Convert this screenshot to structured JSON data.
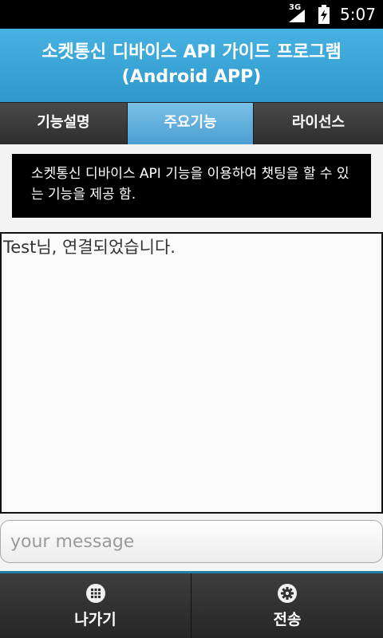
{
  "status_bar": {
    "network": "3G",
    "time": "5:07"
  },
  "header": {
    "title_line1": "소켓통신 디바이스 API 가이드 프로그램",
    "title_line2": "(Android APP)"
  },
  "tabs": [
    {
      "label": "기능설명",
      "active": false
    },
    {
      "label": "주요기능",
      "active": true
    },
    {
      "label": "라이선스",
      "active": false
    }
  ],
  "description": "소켓통신 디바이스 API 기능을 이용하여 챗팅을 할 수 있는 기능을 제공 함.",
  "chat": {
    "messages": [
      "Test님, 연결되었습니다."
    ]
  },
  "message_input": {
    "value": "",
    "placeholder": "your message"
  },
  "bottom_bar": {
    "exit_label": "나가기",
    "exit_icon": "grid-icon",
    "send_label": "전송",
    "send_icon": "gear-icon"
  },
  "colors": {
    "title_bar": "#3aa5d8",
    "active_tab": "#5aaadb",
    "bottom_border": "#1f7fa6"
  }
}
